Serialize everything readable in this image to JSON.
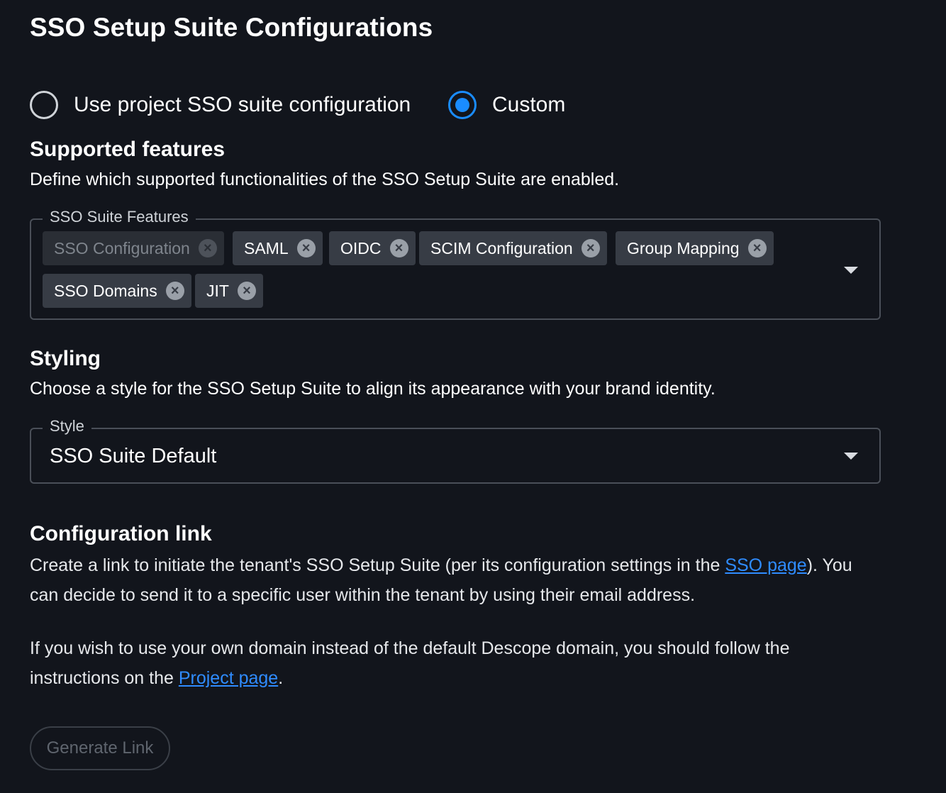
{
  "page": {
    "title": "SSO Setup Suite Configurations"
  },
  "radio_group": {
    "options": [
      {
        "label": "Use project SSO suite configuration",
        "checked": false
      },
      {
        "label": "Custom",
        "checked": true
      }
    ]
  },
  "features_section": {
    "title": "Supported features",
    "description": "Define which supported functionalities of the SSO Setup Suite are enabled.",
    "field_label": "SSO Suite Features",
    "chips": [
      {
        "label": "SSO Configuration",
        "disabled": true
      },
      {
        "label": "SAML",
        "disabled": false
      },
      {
        "label": "OIDC",
        "disabled": false
      },
      {
        "label": "SCIM Configuration",
        "disabled": false
      },
      {
        "label": "Group Mapping",
        "disabled": false
      },
      {
        "label": "SSO Domains",
        "disabled": false
      },
      {
        "label": "JIT",
        "disabled": false
      }
    ]
  },
  "styling_section": {
    "title": "Styling",
    "description": "Choose a style for the SSO Setup Suite to align its appearance with your brand identity.",
    "field_label": "Style",
    "selected_value": "SSO Suite Default"
  },
  "config_link_section": {
    "title": "Configuration link",
    "para1_before": "Create a link to initiate the tenant's SSO Setup Suite (per its configuration settings in the ",
    "para1_link": "SSO page",
    "para1_after": "). You can decide to send it to a specific user within the tenant by using their email address.",
    "para2_before": "If you wish to use your own domain instead of the default Descope domain, you should follow the instructions on the ",
    "para2_link": "Project page",
    "para2_after": ".",
    "button_label": "Generate Link"
  },
  "colors": {
    "background": "#12151c",
    "accent": "#1a8cff",
    "link": "#2f8cff",
    "chip": "#373c45"
  }
}
